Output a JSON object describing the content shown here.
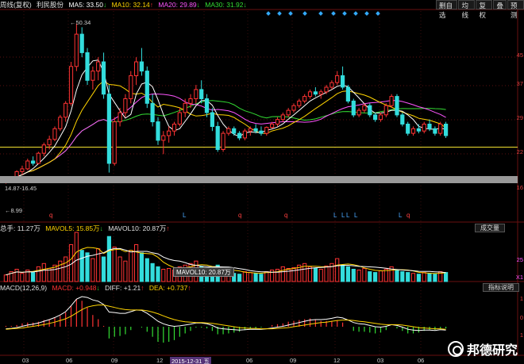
{
  "header": {
    "title": "周线(复权)",
    "stock_name": "利民股份",
    "ma5": {
      "label": "MA5:",
      "value": "33.50",
      "arrow": "↓"
    },
    "ma10": {
      "label": "MA10:",
      "value": "32.14",
      "arrow": "↑"
    },
    "ma20": {
      "label": "MA20:",
      "value": "29.89",
      "arrow": "↓"
    },
    "ma30": {
      "label": "MA30:",
      "value": "31.92",
      "arrow": "↓"
    }
  },
  "toolbar": {
    "items": [
      "删自选",
      "均线",
      "复权",
      "叠",
      "预测"
    ]
  },
  "price_axis": {
    "labels": [
      "45",
      "37",
      "29",
      "22",
      "16"
    ],
    "high_label": "50.34",
    "range_label": "14.87-16.45",
    "low_label": "8.99"
  },
  "volume": {
    "total_label": "总手:",
    "total_value": "11.27万",
    "mavol5_label": "MAVOL5:",
    "mavol5_value": "15.85万",
    "mavol5_arrow": "↓",
    "mavol10_label": "MAVOL10:",
    "mavol10_value": "20.87万",
    "mavol10_arrow": "↑",
    "tab_label": "成交量",
    "tooltip": "MAVOL10: 20.87万",
    "right_labels": [
      "25",
      "X1"
    ]
  },
  "macd": {
    "title": "MACD(12,26,9)",
    "macd_label": "MACD:",
    "macd_value": "+0.948",
    "macd_arrow": "↓",
    "diff_label": "DIFF:",
    "diff_value": "+1.21",
    "diff_arrow": "↑",
    "dea_label": "DEA:",
    "dea_value": "+0.737",
    "dea_arrow": "↑",
    "tab_label": "指标说明",
    "right_labels": [
      "1",
      "0",
      "1"
    ]
  },
  "x_axis": {
    "labels": [
      "03",
      "06",
      "09",
      "12",
      "2015-12-31 五",
      "06",
      "09",
      "12",
      "03",
      "06"
    ]
  },
  "markers": {
    "q": "q",
    "l": "L"
  },
  "watermark": {
    "text": "邦德研究"
  },
  "chart_data": {
    "type": "candlestick",
    "title": "",
    "price_ylim": [
      8.99,
      53
    ],
    "reference_line": 23.5,
    "candles": [
      [
        16,
        16.5,
        15.6,
        16.3
      ],
      [
        16.3,
        17,
        16,
        16.8
      ],
      [
        16.8,
        18.5,
        16.5,
        18.2
      ],
      [
        18.2,
        19.5,
        17.5,
        18.8
      ],
      [
        18.8,
        21,
        18.5,
        20.5
      ],
      [
        20.5,
        21.5,
        19.5,
        20
      ],
      [
        20,
        22.5,
        19.8,
        22.2
      ],
      [
        22.2,
        24.5,
        21.5,
        24
      ],
      [
        24,
        26,
        23,
        25.2
      ],
      [
        25.2,
        28,
        24.8,
        27.5
      ],
      [
        27.5,
        30.5,
        27,
        30
      ],
      [
        30,
        33.5,
        29,
        33
      ],
      [
        33,
        42,
        32.5,
        41
      ],
      [
        41,
        50.34,
        40,
        48
      ],
      [
        48,
        49.5,
        43,
        44
      ],
      [
        44,
        45,
        37,
        38
      ],
      [
        38,
        41,
        36,
        40
      ],
      [
        40,
        43,
        38,
        42
      ],
      [
        42,
        44,
        34,
        35
      ],
      [
        35,
        37,
        18,
        20
      ],
      [
        20,
        30,
        19.5,
        29
      ],
      [
        29,
        32,
        28,
        31
      ],
      [
        31,
        35,
        30,
        34
      ],
      [
        34,
        40,
        33,
        39
      ],
      [
        39,
        43,
        37,
        42
      ],
      [
        42,
        45,
        39,
        40
      ],
      [
        40,
        41,
        32,
        33
      ],
      [
        33,
        35,
        28,
        29
      ],
      [
        29,
        30,
        24,
        25
      ],
      [
        25,
        27,
        22,
        26
      ],
      [
        26,
        28,
        24.5,
        27
      ],
      [
        27,
        29,
        26,
        28.5
      ],
      [
        28.5,
        32,
        28,
        31
      ],
      [
        31,
        34,
        30,
        33
      ],
      [
        33,
        35,
        32,
        34
      ],
      [
        34,
        37,
        33,
        36
      ],
      [
        36,
        38,
        33,
        34
      ],
      [
        34,
        35,
        30,
        31
      ],
      [
        31,
        32,
        27,
        28
      ],
      [
        28,
        29,
        22.5,
        23
      ],
      [
        23,
        27,
        22.5,
        26.5
      ],
      [
        26.5,
        28,
        26,
        27.5
      ],
      [
        27.5,
        28,
        26,
        26.5
      ],
      [
        26.5,
        27,
        25,
        25.5
      ],
      [
        25.5,
        27.5,
        25,
        27
      ],
      [
        27,
        28,
        26,
        27.5
      ],
      [
        27.5,
        28.5,
        26.5,
        27
      ],
      [
        27,
        28,
        26,
        26.5
      ],
      [
        26.5,
        28,
        26,
        27.8
      ],
      [
        27.8,
        29,
        27.5,
        28.5
      ],
      [
        28.5,
        30,
        28,
        29.5
      ],
      [
        29.5,
        31,
        29,
        30.5
      ],
      [
        30.5,
        32,
        30,
        31.5
      ],
      [
        31.5,
        33,
        31,
        32.5
      ],
      [
        32.5,
        34,
        32,
        33.5
      ],
      [
        33.5,
        35,
        33,
        34.5
      ],
      [
        34.5,
        36,
        34,
        35.5
      ],
      [
        35.5,
        36.5,
        34.5,
        35
      ],
      [
        35,
        36,
        34,
        35.5
      ],
      [
        35.5,
        37,
        35,
        36.5
      ],
      [
        36.5,
        38,
        36,
        37.5
      ],
      [
        37.5,
        40,
        37,
        39
      ],
      [
        39,
        41,
        36,
        36.5
      ],
      [
        36.5,
        37,
        33,
        33.5
      ],
      [
        33.5,
        34,
        30,
        30.5
      ],
      [
        30.5,
        32,
        30,
        31.5
      ],
      [
        31.5,
        33,
        31,
        32.5
      ],
      [
        32.5,
        33,
        30,
        30.5
      ],
      [
        30.5,
        31,
        29,
        29.5
      ],
      [
        29.5,
        31,
        29,
        30.5
      ],
      [
        30.5,
        33,
        30,
        32.5
      ],
      [
        32.5,
        35,
        32,
        34.5
      ],
      [
        34.5,
        35,
        30,
        30.5
      ],
      [
        30.5,
        31,
        28,
        28.5
      ],
      [
        28.5,
        29,
        26,
        26.5
      ],
      [
        26.5,
        28,
        26,
        27.5
      ],
      [
        27.5,
        28.5,
        26.5,
        27
      ],
      [
        27,
        29,
        26.5,
        28.5
      ],
      [
        28.5,
        29.5,
        27,
        27.5
      ],
      [
        27.5,
        28,
        26,
        26.5
      ],
      [
        26.5,
        29,
        26,
        28.5
      ],
      [
        28.5,
        29,
        25.5,
        26
      ]
    ],
    "volumes": [
      8,
      12,
      15,
      10,
      14,
      11,
      18,
      22,
      16,
      20,
      25,
      30,
      45,
      60,
      38,
      35,
      28,
      40,
      30,
      55,
      42,
      30,
      25,
      38,
      45,
      35,
      28,
      22,
      18,
      15,
      16,
      14,
      18,
      20,
      22,
      25,
      18,
      15,
      12,
      20,
      14,
      12,
      10,
      9,
      12,
      11,
      10,
      9,
      12,
      14,
      15,
      18,
      16,
      17,
      20,
      22,
      18,
      16,
      15,
      19,
      22,
      28,
      20,
      18,
      15,
      14,
      16,
      12,
      11,
      13,
      15,
      18,
      14,
      12,
      11,
      10,
      9,
      11,
      10,
      9,
      12,
      11
    ],
    "macd_diff": [
      -0.5,
      -0.4,
      -0.2,
      0.1,
      0.4,
      0.6,
      0.9,
      1.3,
      1.7,
      2.2,
      2.8,
      3.6,
      5.0,
      6.6,
      7.2,
      7.0,
      6.4,
      6.1,
      5.3,
      3.5,
      3.4,
      3.2,
      3.2,
      3.6,
      4.0,
      3.9,
      3.2,
      2.3,
      1.3,
      0.7,
      0.3,
      0.1,
      0.2,
      0.4,
      0.6,
      0.9,
      0.9,
      0.7,
      0.3,
      -0.3,
      -0.5,
      -0.6,
      -0.7,
      -0.8,
      -0.7,
      -0.6,
      -0.6,
      -0.6,
      -0.5,
      -0.3,
      -0.1,
      0.1,
      0.4,
      0.7,
      1.0,
      1.3,
      1.6,
      1.7,
      1.7,
      1.8,
      2.0,
      2.3,
      2.1,
      1.6,
      1.0,
      0.7,
      0.6,
      0.3,
      0.0,
      -0.1,
      0.1,
      0.5,
      0.3,
      -0.1,
      -0.6,
      -0.8,
      -0.9,
      -0.8,
      -0.8,
      -0.9,
      -0.7,
      -0.8
    ],
    "macd_dea": [
      -0.6,
      -0.5,
      -0.4,
      -0.3,
      -0.1,
      0.1,
      0.3,
      0.5,
      0.8,
      1.1,
      1.5,
      1.9,
      2.5,
      3.3,
      4.1,
      4.7,
      5.0,
      5.2,
      5.2,
      4.9,
      4.6,
      4.3,
      4.1,
      4.0,
      4.0,
      4.0,
      3.8,
      3.5,
      3.1,
      2.6,
      2.1,
      1.7,
      1.4,
      1.2,
      1.1,
      1.0,
      1.0,
      0.9,
      0.8,
      0.6,
      0.4,
      0.2,
      0.0,
      -0.2,
      -0.3,
      -0.4,
      -0.4,
      -0.5,
      -0.5,
      -0.5,
      -0.4,
      -0.3,
      -0.2,
      0.0,
      0.2,
      0.4,
      0.6,
      0.8,
      1.0,
      1.1,
      1.3,
      1.5,
      1.6,
      1.6,
      1.5,
      1.3,
      1.2,
      1.0,
      0.8,
      0.6,
      0.5,
      0.5,
      0.5,
      0.4,
      0.2,
      0.0,
      -0.2,
      -0.3,
      -0.4,
      -0.5,
      -0.5,
      -0.6
    ]
  }
}
